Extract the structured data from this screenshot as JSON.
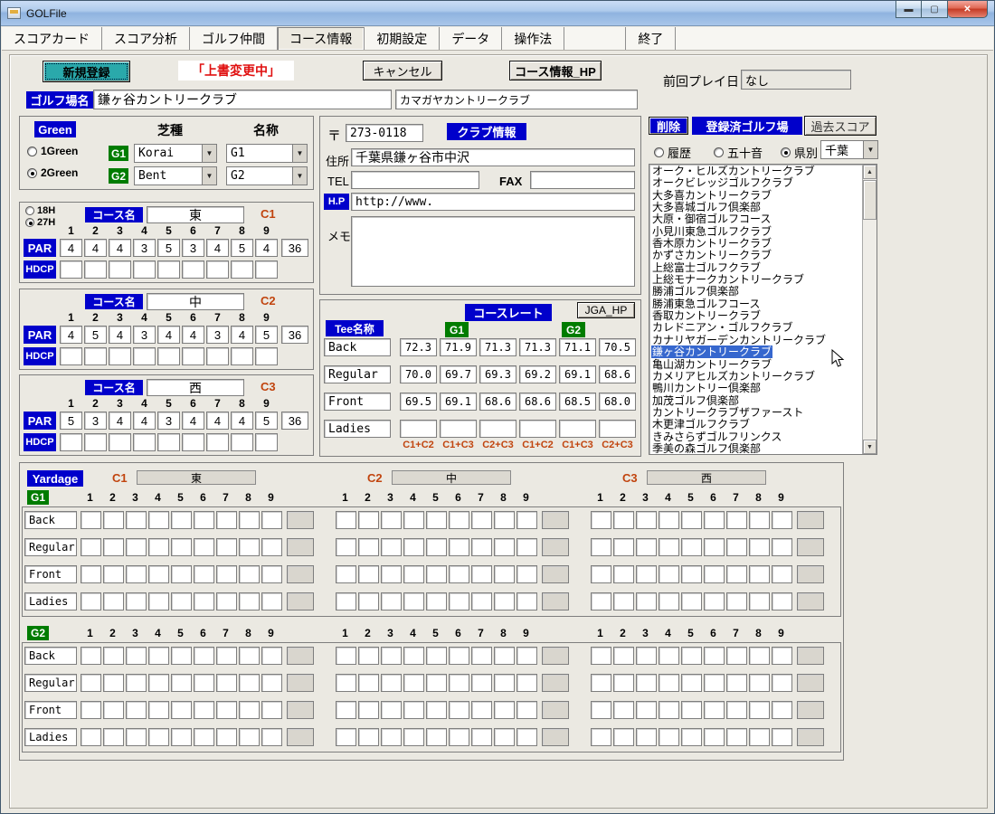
{
  "window": {
    "title": "GOLFile"
  },
  "menu": {
    "items": [
      {
        "label": "スコアカード",
        "active": false
      },
      {
        "label": "スコア分析",
        "active": false
      },
      {
        "label": "ゴルフ仲間",
        "active": false
      },
      {
        "label": "コース情報",
        "active": true
      },
      {
        "label": "初期設定",
        "active": false
      },
      {
        "label": "データ",
        "active": false
      },
      {
        "label": "操作法",
        "active": false
      },
      {
        "label": "",
        "active": false
      },
      {
        "label": "終了",
        "active": false
      }
    ]
  },
  "toolbar": {
    "new_button": "新規登録",
    "overwrite_status": "「上書変更中」",
    "cancel_button": "キャンセル",
    "course_hp_button": "コース情報_HP",
    "last_play_label": "前回プレイ日",
    "last_play_value": "なし"
  },
  "course_name": {
    "label": "ゴルフ場名",
    "kanji": "鎌ヶ谷カントリークラブ",
    "kana": "カマガヤカントリークラブ"
  },
  "green_panel": {
    "title": "Green",
    "options": [
      "1Green",
      "2Green"
    ],
    "selected": "2Green",
    "grass_header": "芝種",
    "name_header": "名称",
    "rows": [
      {
        "tag": "G1",
        "grass": "Korai",
        "name": "G1"
      },
      {
        "tag": "G2",
        "grass": "Bent",
        "name": "G2"
      }
    ]
  },
  "holes": {
    "options": [
      "18H",
      "27H"
    ],
    "selected": "27H",
    "course_label": "コース名",
    "par_label": "PAR",
    "hdcp_label": "HDCP",
    "numbers": [
      "1",
      "2",
      "3",
      "4",
      "5",
      "6",
      "7",
      "8",
      "9"
    ],
    "courses": [
      {
        "tag": "C1",
        "name": "東",
        "par": [
          "4",
          "4",
          "4",
          "3",
          "5",
          "3",
          "4",
          "5",
          "4"
        ],
        "total": "36",
        "hdcp": [
          "",
          "",
          "",
          "",
          "",
          "",
          "",
          "",
          ""
        ]
      },
      {
        "tag": "C2",
        "name": "中",
        "par": [
          "4",
          "5",
          "4",
          "3",
          "4",
          "4",
          "3",
          "4",
          "5"
        ],
        "total": "36",
        "hdcp": [
          "",
          "",
          "",
          "",
          "",
          "",
          "",
          "",
          ""
        ]
      },
      {
        "tag": "C3",
        "name": "西",
        "par": [
          "5",
          "3",
          "4",
          "4",
          "3",
          "4",
          "4",
          "4",
          "5"
        ],
        "total": "36",
        "hdcp": [
          "",
          "",
          "",
          "",
          "",
          "",
          "",
          "",
          ""
        ]
      }
    ]
  },
  "club_info": {
    "title": "クラブ情報",
    "zip_label": "〒",
    "zip_value": "273-0118",
    "address_label": "住所",
    "address_value": "千葉県鎌ヶ谷市中沢",
    "tel_label": "TEL",
    "tel_value": "",
    "fax_label": "FAX",
    "fax_value": "",
    "hp_label": "H.P",
    "hp_value": "http://www.",
    "memo_label": "メモ",
    "memo_value": ""
  },
  "course_rate": {
    "title": "コースレート",
    "jga_button": "JGA_HP",
    "tee_header": "Tee名称",
    "green_headers": [
      "G1",
      "G2"
    ],
    "rows": [
      {
        "tee": "Back",
        "values": [
          "72.3",
          "71.9",
          "71.3",
          "71.3",
          "71.1",
          "70.5"
        ]
      },
      {
        "tee": "Regular",
        "values": [
          "70.0",
          "69.7",
          "69.3",
          "69.2",
          "69.1",
          "68.6"
        ]
      },
      {
        "tee": "Front",
        "values": [
          "69.5",
          "69.1",
          "68.6",
          "68.6",
          "68.5",
          "68.0"
        ]
      },
      {
        "tee": "Ladies",
        "values": [
          "",
          "",
          "",
          "",
          "",
          ""
        ]
      }
    ],
    "combo_labels": [
      "C1+C2",
      "C1+C3",
      "C2+C3",
      "C1+C2",
      "C1+C3",
      "C2+C3"
    ]
  },
  "registered": {
    "delete_button": "削除",
    "title": "登録済ゴルフ場",
    "past_score_button": "過去スコア",
    "filter_options": [
      "履歴",
      "五十音",
      "県別"
    ],
    "filter_selected": "県別",
    "prefecture": "千葉",
    "selected_index": 15,
    "items": [
      "オーク・ヒルズカントリークラブ",
      "オークビレッジゴルフクラブ",
      "大多喜カントリークラブ",
      "大多喜城ゴルフ倶楽部",
      "大原・御宿ゴルフコース",
      "小見川東急ゴルフクラブ",
      "香木原カントリークラブ",
      "かずさカントリークラブ",
      "上総富士ゴルフクラブ",
      "上総モナークカントリークラブ",
      "勝浦ゴルフ倶楽部",
      "勝浦東急ゴルフコース",
      "香取カントリークラブ",
      "カレドニアン・ゴルフクラブ",
      "カナリヤガーデンカントリークラブ",
      "鎌ヶ谷カントリークラブ",
      "亀山湖カントリークラブ",
      "カメリアヒルズカントリークラブ",
      "鴨川カントリー倶楽部",
      "加茂ゴルフ倶楽部",
      "カントリークラブザファースト",
      "木更津ゴルフクラブ",
      "きみさらずゴルフリンクス",
      "季美の森ゴルフ倶楽部"
    ]
  },
  "yardage": {
    "title": "Yardage",
    "numbers": [
      "1",
      "2",
      "3",
      "4",
      "5",
      "6",
      "7",
      "8",
      "9"
    ],
    "course_headers": [
      {
        "tag": "C1",
        "name": "東"
      },
      {
        "tag": "C2",
        "name": "中"
      },
      {
        "tag": "C3",
        "name": "西"
      }
    ],
    "tees": [
      "Back",
      "Regular",
      "Front",
      "Ladies"
    ],
    "greens": [
      "G1",
      "G2"
    ]
  }
}
